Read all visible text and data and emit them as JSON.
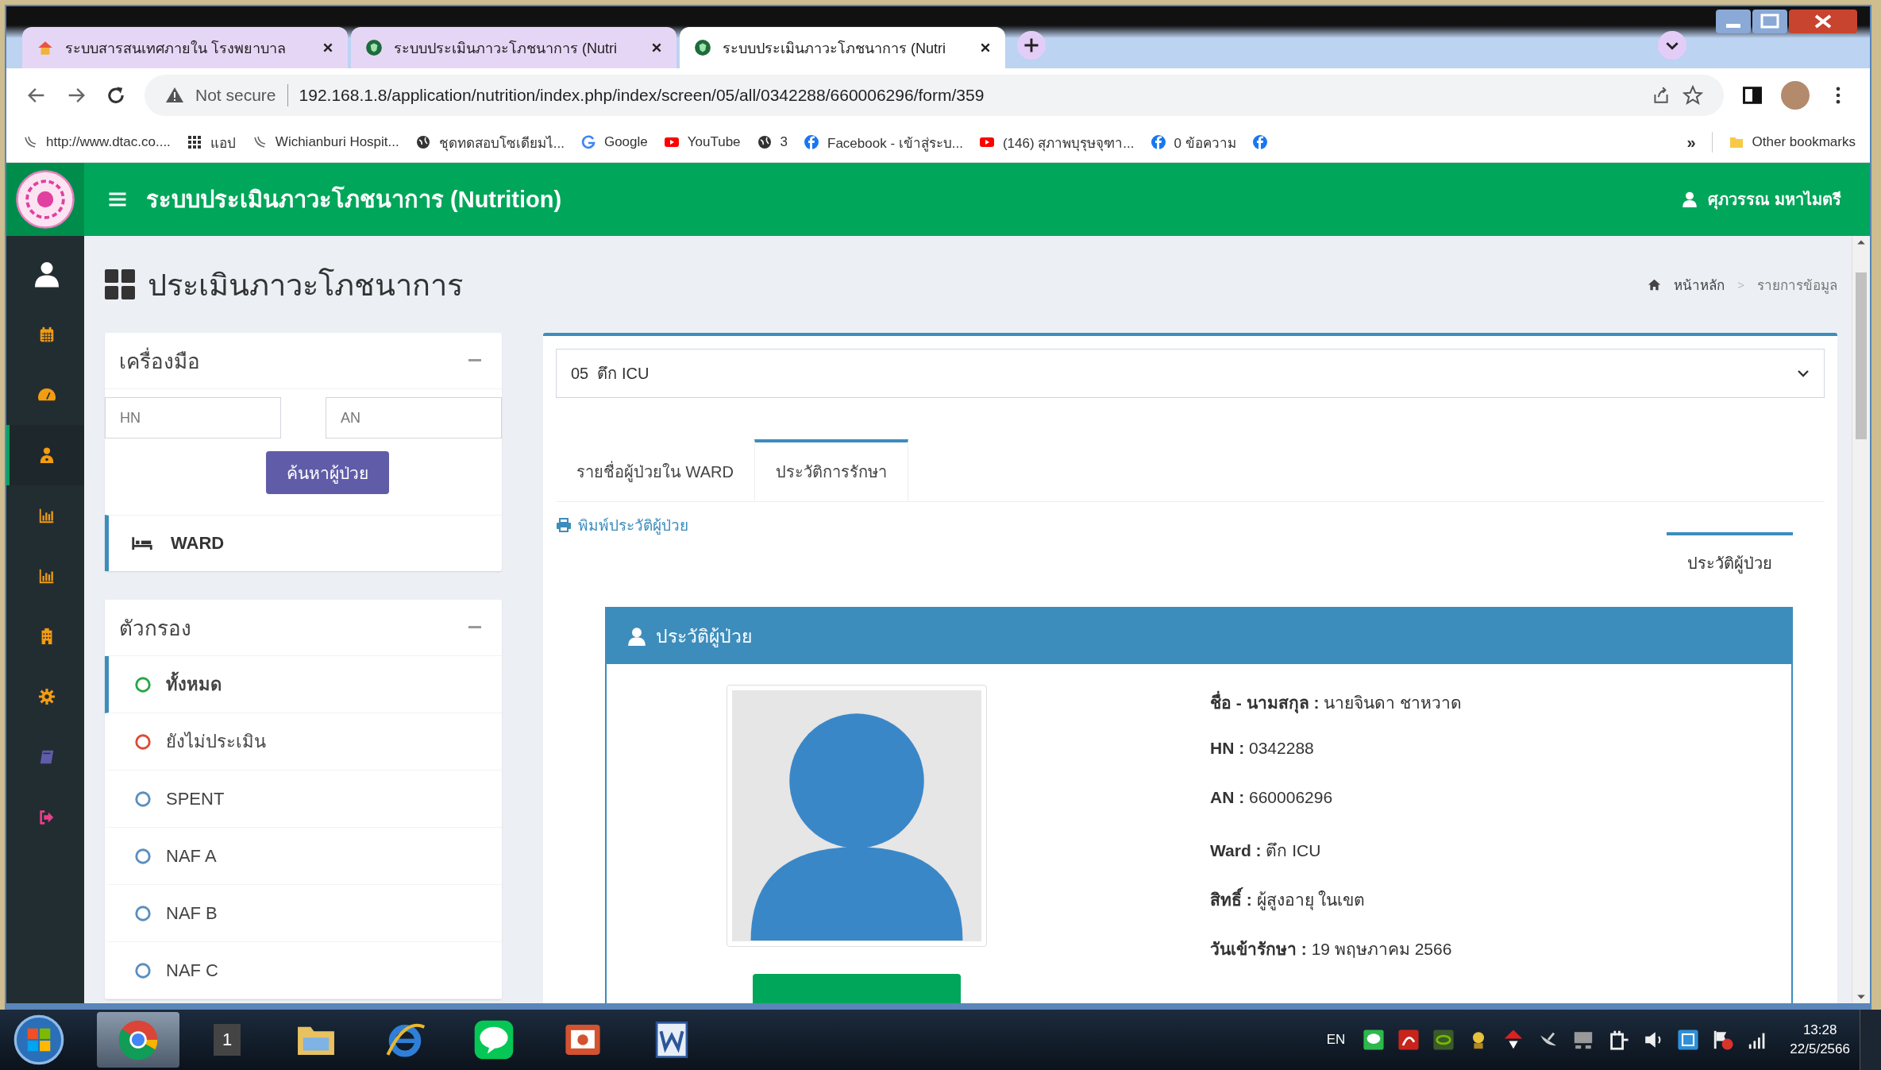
{
  "browser": {
    "tabs": [
      {
        "title": "ระบบสารสนเทศภายใน โรงพยาบาล",
        "kind": "home",
        "selected": false
      },
      {
        "title": "ระบบประเมินภาวะโภชนาการ (Nutri",
        "kind": "shield",
        "selected": false
      },
      {
        "title": "ระบบประเมินภาวะโภชนาการ (Nutri",
        "kind": "shield",
        "selected": true
      }
    ],
    "security": "Not secure",
    "url": "192.168.1.8/application/nutrition/index.php/index/screen/05/all/0342288/660006296/form/359",
    "bookmarks": [
      {
        "label": "http://www.dtac.co....",
        "kind": "wave"
      },
      {
        "label": "แอป",
        "kind": "apps"
      },
      {
        "label": "Wichianburi Hospit...",
        "kind": "wave"
      },
      {
        "label": "ชุดทดสอบโซเดียมไ...",
        "kind": "globe"
      },
      {
        "label": "Google",
        "kind": "google"
      },
      {
        "label": "YouTube",
        "kind": "youtube"
      },
      {
        "label": "3",
        "kind": "globe"
      },
      {
        "label": "Facebook - เข้าสู่ระบ...",
        "kind": "facebook"
      },
      {
        "label": "(146) สุภาพบุรุษจุฑา...",
        "kind": "youtube"
      },
      {
        "label": "0 ข้อความ",
        "kind": "facebook"
      },
      {
        "kind": "facebook"
      }
    ],
    "more": "»",
    "other_bookmarks": "Other bookmarks"
  },
  "app": {
    "title": "ระบบประเมินภาวะโภชนาการ (Nutrition)",
    "user": "ศุภวรรณ มหาไมตรี",
    "nav": [
      {
        "kind": "user",
        "selected": false
      },
      {
        "kind": "calendar",
        "selected": false
      },
      {
        "kind": "dashboard",
        "selected": false
      },
      {
        "kind": "doctor",
        "selected": true
      },
      {
        "kind": "chart",
        "selected": false
      },
      {
        "kind": "chart",
        "selected": false
      },
      {
        "kind": "building",
        "selected": false
      },
      {
        "kind": "gear",
        "selected": false
      },
      {
        "kind": "book",
        "selected": false
      },
      {
        "kind": "logout",
        "selected": false
      }
    ],
    "page_title": "ประเมินภาวะโภชนาการ",
    "breadcrumb": {
      "home": "หน้าหลัก",
      "separator": ">",
      "current": "รายการข้อมูล"
    },
    "tools": {
      "title": "เครื่องมือ",
      "hn_placeholder": "HN",
      "an_placeholder": "AN",
      "search_button": "ค้นหาผู้ป่วย",
      "ward_link": "WARD"
    },
    "filters": {
      "title": "ตัวกรอง",
      "items": [
        {
          "label": "ทั้งหมด",
          "color": "#28a745",
          "selected": true
        },
        {
          "label": "ยังไม่ประเมิน",
          "color": "#dd4b39",
          "selected": false
        },
        {
          "label": "SPENT",
          "color": "#5b8fc0",
          "selected": false
        },
        {
          "label": "NAF A",
          "color": "#5b8fc0",
          "selected": false
        },
        {
          "label": "NAF B",
          "color": "#5b8fc0",
          "selected": false
        },
        {
          "label": "NAF C",
          "color": "#5b8fc0",
          "selected": false
        }
      ]
    },
    "ward_select": "05  ตึก ICU",
    "tabs": [
      {
        "label": "รายชื่อผู้ป่วยใน WARD",
        "selected": false
      },
      {
        "label": "ประวัติการรักษา",
        "selected": true
      }
    ],
    "print_link": "พิมพ์ประวัติผู้ป่วย",
    "subtabs": [
      {
        "label": "ประวัติผู้ป่วย",
        "selected": true
      }
    ],
    "patient": {
      "title": "ประวัติผู้ป่วย",
      "fields": [
        "**ชื่อ - นามสกุล :** นายจินดา ชาหวาด",
        "**HN :** 0342288",
        "**AN :** 660006296",
        "**Ward :** ตึก ICU",
        "**สิทธิ์ :** ผู้สูงอายุ ในเขต",
        "**วันเข้ารักษา :** 19 พฤษภาคม 2566"
      ]
    }
  },
  "taskbar": {
    "apps": [
      {
        "kind": "chrome",
        "selected": true
      },
      {
        "kind": "count",
        "label": "1",
        "selected": false
      },
      {
        "kind": "folder",
        "selected": false
      },
      {
        "kind": "ie",
        "selected": false
      },
      {
        "kind": "line",
        "selected": false
      },
      {
        "kind": "slides",
        "selected": false
      },
      {
        "kind": "word",
        "selected": false
      }
    ],
    "lang": "EN",
    "time": "13:28",
    "date": "22/5/2566"
  }
}
